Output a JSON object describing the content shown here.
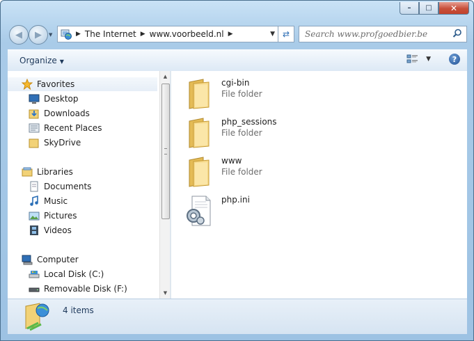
{
  "window": {
    "minimize_glyph": "–",
    "maximize_glyph": "□",
    "close_glyph": "✕"
  },
  "navigation": {
    "back_glyph": "◀",
    "forward_glyph": "▶",
    "breadcrumb": [
      "The Internet",
      "www.voorbeeld.nl"
    ],
    "refresh_glyph": "⇄"
  },
  "search": {
    "placeholder": "Search www.profgoedbier.be"
  },
  "toolbar": {
    "organize_label": "Organize",
    "view_glyph": "▾",
    "help_label": "?"
  },
  "sidebar": {
    "favorites": {
      "label": "Favorites",
      "items": [
        "Desktop",
        "Downloads",
        "Recent Places",
        "SkyDrive"
      ]
    },
    "libraries": {
      "label": "Libraries",
      "items": [
        "Documents",
        "Music",
        "Pictures",
        "Videos"
      ]
    },
    "computer": {
      "label": "Computer",
      "items": [
        "Local Disk (C:)",
        "Removable Disk (F:)"
      ]
    }
  },
  "files": [
    {
      "name": "cgi-bin",
      "type": "File folder"
    },
    {
      "name": "php_sessions",
      "type": "File folder"
    },
    {
      "name": "www",
      "type": "File folder"
    },
    {
      "name": "php.ini",
      "type": ""
    }
  ],
  "status": {
    "item_count": "4 items"
  },
  "colors": {
    "window_frame": "#a9cbe8",
    "toolbar": "#dde9f5",
    "folder": "#f2d277",
    "close_button": "#c74f3a"
  }
}
